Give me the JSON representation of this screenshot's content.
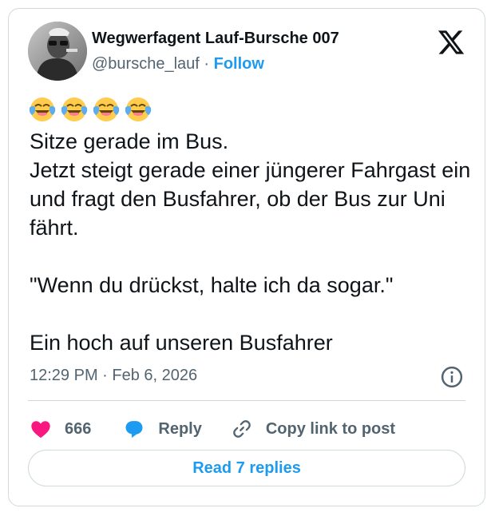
{
  "author": {
    "name": "Wegwerfagent Lauf-Bursche 007",
    "handle": "@bursche_lauf",
    "separator": "·",
    "follow_label": "Follow",
    "avatar_icon": "avatar-photo"
  },
  "platform_logo": "x-logo-icon",
  "tweet": {
    "emojis": [
      "face-with-tears-of-joy",
      "face-with-tears-of-joy",
      "face-with-tears-of-joy",
      "face-with-tears-of-joy"
    ],
    "text": "Sitze gerade im Bus.\nJetzt steigt gerade einer jüngerer Fahrgast ein und fragt den Busfahrer, ob der Bus zur Uni fährt.\n\n\"Wenn du drückst, halte ich da sogar.\"\n\nEin hoch auf unseren Busfahrer",
    "time": "12:29 PM",
    "date_separator": "·",
    "date": "Feb 6, 2026"
  },
  "actions": {
    "like_count": "666",
    "reply_label": "Reply",
    "copy_label": "Copy link to post"
  },
  "read_replies_label": "Read 7 replies",
  "colors": {
    "accent": "#1d9bf0",
    "like": "#f91880",
    "text": "#0f1419",
    "muted": "#536471",
    "border": "#cfd9de"
  }
}
